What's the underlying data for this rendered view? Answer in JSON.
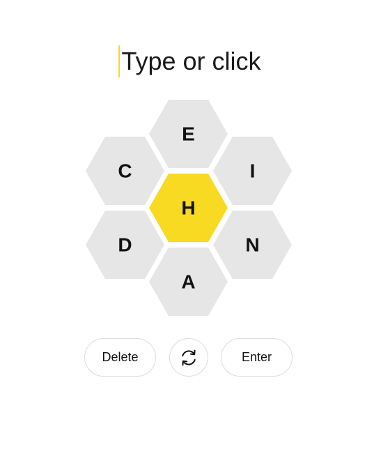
{
  "input": {
    "placeholder": "Type or click"
  },
  "hive": {
    "center_letter": "H",
    "outer_letters": [
      "E",
      "C",
      "I",
      "D",
      "N",
      "A"
    ]
  },
  "controls": {
    "delete_label": "Delete",
    "shuffle_icon": "shuffle-icon",
    "enter_label": "Enter"
  },
  "colors": {
    "center_cell": "#f7da21",
    "outer_cell": "#e6e6e6",
    "caret": "#f7da21"
  }
}
